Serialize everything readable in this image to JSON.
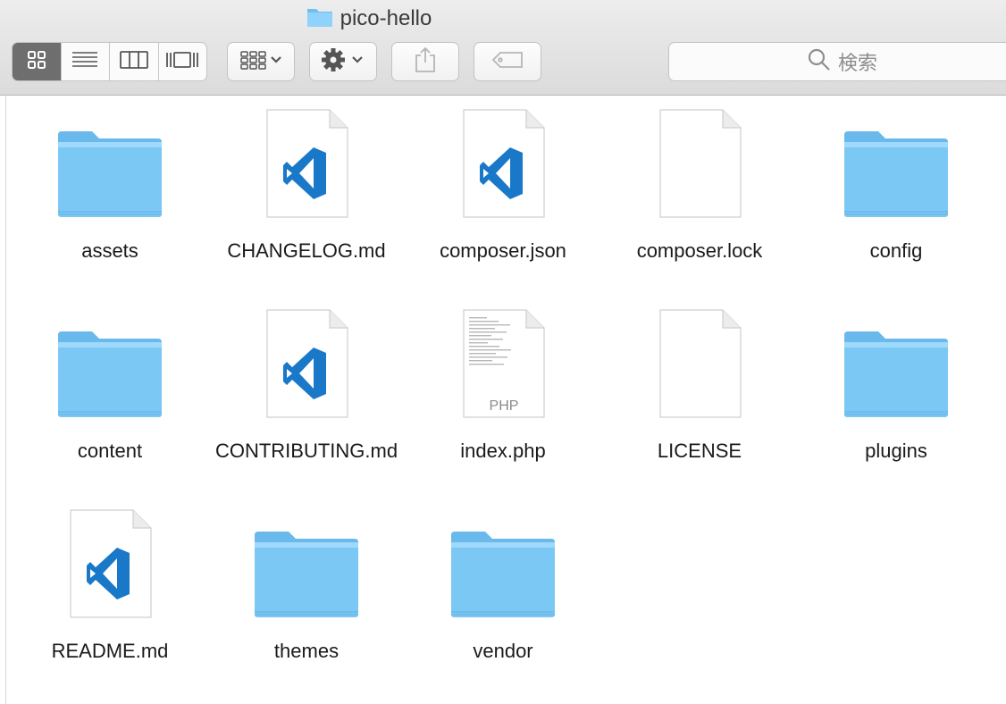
{
  "window": {
    "title": "pico-hello"
  },
  "toolbar": {
    "view_modes": [
      {
        "name": "icon-view",
        "active": true
      },
      {
        "name": "list-view",
        "active": false
      },
      {
        "name": "column-view",
        "active": false
      },
      {
        "name": "gallery-view",
        "active": false
      }
    ],
    "search_placeholder": "検索"
  },
  "files": [
    {
      "name": "assets",
      "kind": "folder"
    },
    {
      "name": "CHANGELOG.md",
      "kind": "vscode"
    },
    {
      "name": "composer.json",
      "kind": "vscode"
    },
    {
      "name": "composer.lock",
      "kind": "blank"
    },
    {
      "name": "config",
      "kind": "folder"
    },
    {
      "name": "content",
      "kind": "folder"
    },
    {
      "name": "CONTRIBUTING.md",
      "kind": "vscode"
    },
    {
      "name": "index.php",
      "kind": "php",
      "badge": "PHP"
    },
    {
      "name": "LICENSE",
      "kind": "blank"
    },
    {
      "name": "plugins",
      "kind": "folder"
    },
    {
      "name": "README.md",
      "kind": "vscode"
    },
    {
      "name": "themes",
      "kind": "folder"
    },
    {
      "name": "vendor",
      "kind": "folder"
    }
  ],
  "colors": {
    "folder": "#7cc8f5",
    "folder_tab": "#9fd9fb",
    "vscode_blue": "#1a78c8"
  }
}
